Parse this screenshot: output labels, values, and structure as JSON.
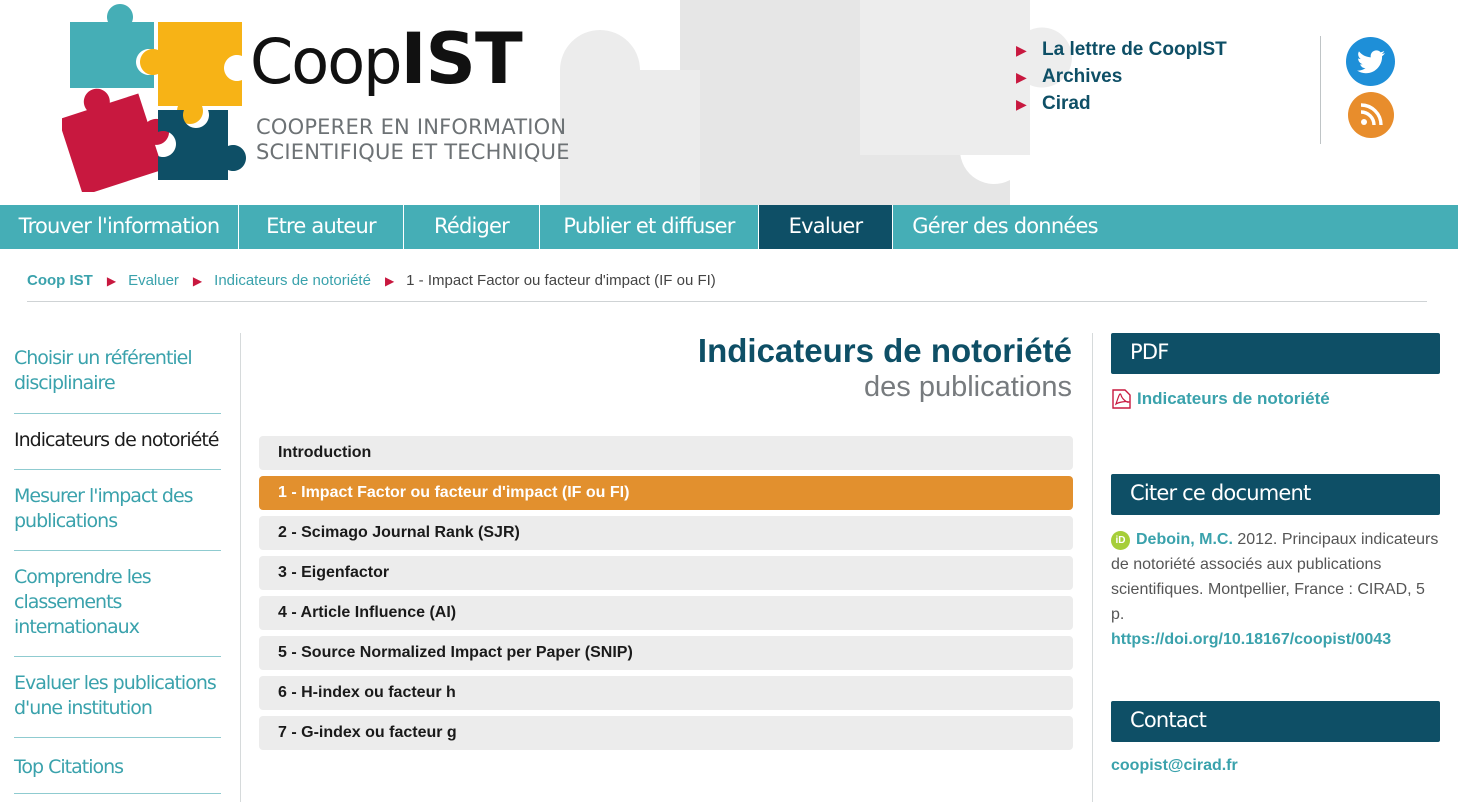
{
  "brand": {
    "name_light": "Coop",
    "name_bold": "IST",
    "subtitle_line1": "COOPERER EN INFORMATION",
    "subtitle_line2": "SCIENTIFIQUE ET TECHNIQUE"
  },
  "top_links": [
    {
      "label": "La lettre de CoopIST"
    },
    {
      "label": "Archives"
    },
    {
      "label": "Cirad"
    }
  ],
  "social": {
    "twitter": "twitter-icon",
    "rss": "rss-icon"
  },
  "nav": [
    {
      "label": "Trouver l'information"
    },
    {
      "label": "Etre auteur"
    },
    {
      "label": "Rédiger"
    },
    {
      "label": "Publier et diffuser"
    },
    {
      "label": "Evaluer"
    },
    {
      "label": "Gérer des données"
    }
  ],
  "nav_active_index": 4,
  "breadcrumb": {
    "home": "Coop IST",
    "level1": "Evaluer",
    "level2": "Indicateurs de notoriété",
    "current": "1 - Impact Factor ou facteur d'impact (IF ou FI)"
  },
  "sidebar": [
    {
      "label": "Choisir un référentiel disciplinaire"
    },
    {
      "label": "Indicateurs de notoriété"
    },
    {
      "label": "Mesurer l'impact des publications"
    },
    {
      "label": "Comprendre les classements internationaux"
    },
    {
      "label": "Evaluer les publications d'une institution"
    },
    {
      "label": "Top Citations"
    }
  ],
  "main": {
    "title": "Indicateurs de notoriété",
    "subtitle": "des publications",
    "toc": [
      {
        "label": "Introduction"
      },
      {
        "label": "1 - Impact Factor ou facteur d'impact (IF ou FI)"
      },
      {
        "label": "2 - Scimago Journal Rank (SJR)"
      },
      {
        "label": "3 - Eigenfactor"
      },
      {
        "label": "4 - Article Influence (AI)"
      },
      {
        "label": "5 - Source Normalized Impact per Paper (SNIP)"
      },
      {
        "label": "6 - H-index ou facteur h"
      },
      {
        "label": "7 - G-index ou facteur g"
      }
    ]
  },
  "right": {
    "pdf_heading": "PDF",
    "pdf_link": "Indicateurs de notoriété",
    "cite_heading": "Citer ce document",
    "cite_author": "Deboin, M.C.",
    "cite_text": " 2012. Principaux indicateurs de notoriété associés aux publications scientifiques. Montpellier, France : CIRAD, 5 p.",
    "cite_doi": "https://doi.org/10.18167/coopist/0043",
    "orcid_label": "iD",
    "contact_heading": "Contact",
    "contact_email": "coopist@cirad.fr"
  },
  "colors": {
    "teal": "#45aeb6",
    "navy": "#0e4f66",
    "orange": "#e2902e",
    "crimson": "#c8183f",
    "puzzle_yellow": "#f7b316"
  }
}
